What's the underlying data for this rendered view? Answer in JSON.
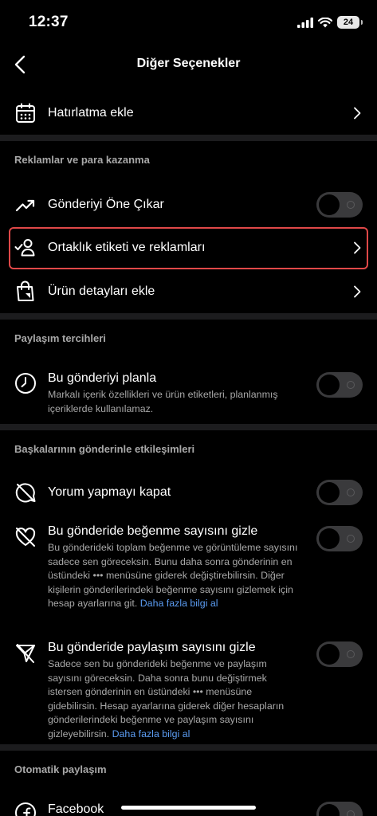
{
  "status_bar": {
    "time": "12:37",
    "battery": "24"
  },
  "nav": {
    "title": "Diğer Seçenekler"
  },
  "reminder": {
    "label": "Hatırlatma ekle"
  },
  "ads_section": {
    "title": "Reklamlar ve para kazanma",
    "boost_label": "Gönderiyi Öne Çıkar",
    "partnership_label": "Ortaklık etiketi ve reklamları",
    "product_label": "Ürün detayları ekle"
  },
  "sharing_section": {
    "title": "Paylaşım tercihleri",
    "schedule_title": "Bu gönderiyi planla",
    "schedule_desc": "Markalı içerik özellikleri ve ürün etiketleri, planlanmış içeriklerde kullanılamaz."
  },
  "interactions_section": {
    "title": "Başkalarının gönderinle etkileşimleri",
    "comments_label": "Yorum yapmayı kapat",
    "likes_title": "Bu gönderide beğenme sayısını gizle",
    "likes_desc": "Bu gönderideki toplam beğenme ve görüntüleme sayısını sadece sen göreceksin. Bunu daha sonra gönderinin en üstündeki ••• menüsüne giderek değiştirebilirsin. Diğer kişilerin gönderilerindeki beğenme sayısını gizlemek için hesap ayarlarına git.",
    "likes_link": "Daha fazla bilgi al",
    "shares_title": "Bu gönderide paylaşım sayısını gizle",
    "shares_desc": "Sadece sen bu gönderideki beğenme ve paylaşım sayısını göreceksin. Daha sonra bunu değiştirmek istersen gönderinin en üstündeki ••• menüsüne gidebilirsin. Hesap ayarlarına giderek diğer hesapların gönderilerindeki beğenme ve paylaşım sayısını gizleyebilirsin.",
    "shares_link": "Daha fazla bilgi al"
  },
  "auto_share_section": {
    "title": "Otomatik paylaşım",
    "facebook_label": "Facebook"
  }
}
